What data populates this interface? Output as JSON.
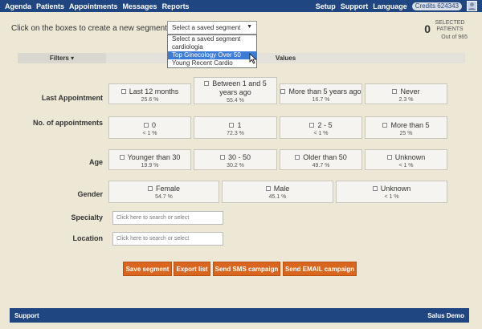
{
  "nav": {
    "left": [
      "Agenda",
      "Patients",
      "Appointments",
      "Messages",
      "Reports"
    ],
    "right": [
      "Setup",
      "Support",
      "Language"
    ],
    "credits": "Credits 624343"
  },
  "header": {
    "instruction": "Click on the boxes to create a new segment or",
    "select_value": "Select a saved segment",
    "dropdown_options": [
      "Select a saved segment",
      "cardiologia",
      "Top Ginecology Over 50",
      "Young Recent Cardio"
    ],
    "selected_option_index": 2,
    "selected_count": "0",
    "selected_label": "SELECTED PATIENTS",
    "out_of": "Out of 965"
  },
  "table_header": {
    "filters": "Filters ▾",
    "values": "Values"
  },
  "filters": {
    "last_appointment": {
      "label": "Last Appointment",
      "options": [
        {
          "title": "Last 12 months",
          "pct": "25.6 %"
        },
        {
          "title": "Between 1 and 5 years ago",
          "pct": "55.4 %"
        },
        {
          "title": "More than 5 years ago",
          "pct": "16.7 %"
        },
        {
          "title": "Never",
          "pct": "2.3 %"
        }
      ]
    },
    "num_appointments": {
      "label": "No. of appointments",
      "options": [
        {
          "title": "0",
          "pct": "< 1 %"
        },
        {
          "title": "1",
          "pct": "72.3 %"
        },
        {
          "title": "2 - 5",
          "pct": "< 1 %"
        },
        {
          "title": "More than 5",
          "pct": "25 %"
        }
      ]
    },
    "age": {
      "label": "Age",
      "options": [
        {
          "title": "Younger than 30",
          "pct": "19.9 %"
        },
        {
          "title": "30 - 50",
          "pct": "30.2 %"
        },
        {
          "title": "Older than 50",
          "pct": "49.7 %"
        },
        {
          "title": "Unknown",
          "pct": "< 1 %"
        }
      ]
    },
    "gender": {
      "label": "Gender",
      "options": [
        {
          "title": "Female",
          "pct": "54.7 %"
        },
        {
          "title": "Male",
          "pct": "45.1 %"
        },
        {
          "title": "Unknown",
          "pct": "< 1 %"
        }
      ]
    },
    "specialty": {
      "label": "Specialty",
      "placeholder": "Click here to search or select"
    },
    "location": {
      "label": "Location",
      "placeholder": "Click here to search or select"
    }
  },
  "buttons": {
    "save": "Save segment",
    "export": "Export list",
    "sms": "Send SMS campaign",
    "email": "Send EMAIL campaign"
  },
  "footer": {
    "left": "Support",
    "right": "Salus Demo"
  }
}
